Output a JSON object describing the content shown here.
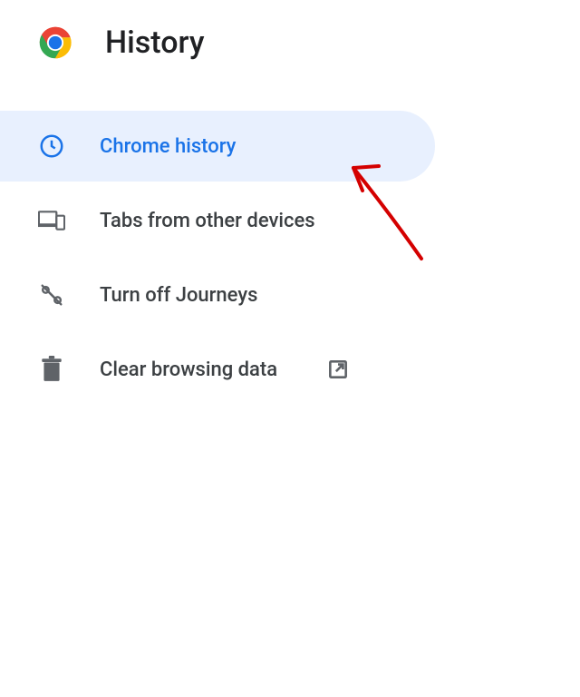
{
  "header": {
    "title": "History"
  },
  "nav": {
    "items": [
      {
        "label": "Chrome history",
        "selected": true,
        "icon": "clock-icon"
      },
      {
        "label": "Tabs from other devices",
        "selected": false,
        "icon": "devices-icon"
      },
      {
        "label": "Turn off Journeys",
        "selected": false,
        "icon": "journeys-off-icon"
      },
      {
        "label": "Clear browsing data",
        "selected": false,
        "icon": "trash-icon",
        "external": true
      }
    ]
  },
  "colors": {
    "accent": "#1a73e8",
    "selectedBg": "#e8f0fe",
    "text": "#3c4043",
    "iconGray": "#5f6368",
    "annotation": "#d40000"
  }
}
